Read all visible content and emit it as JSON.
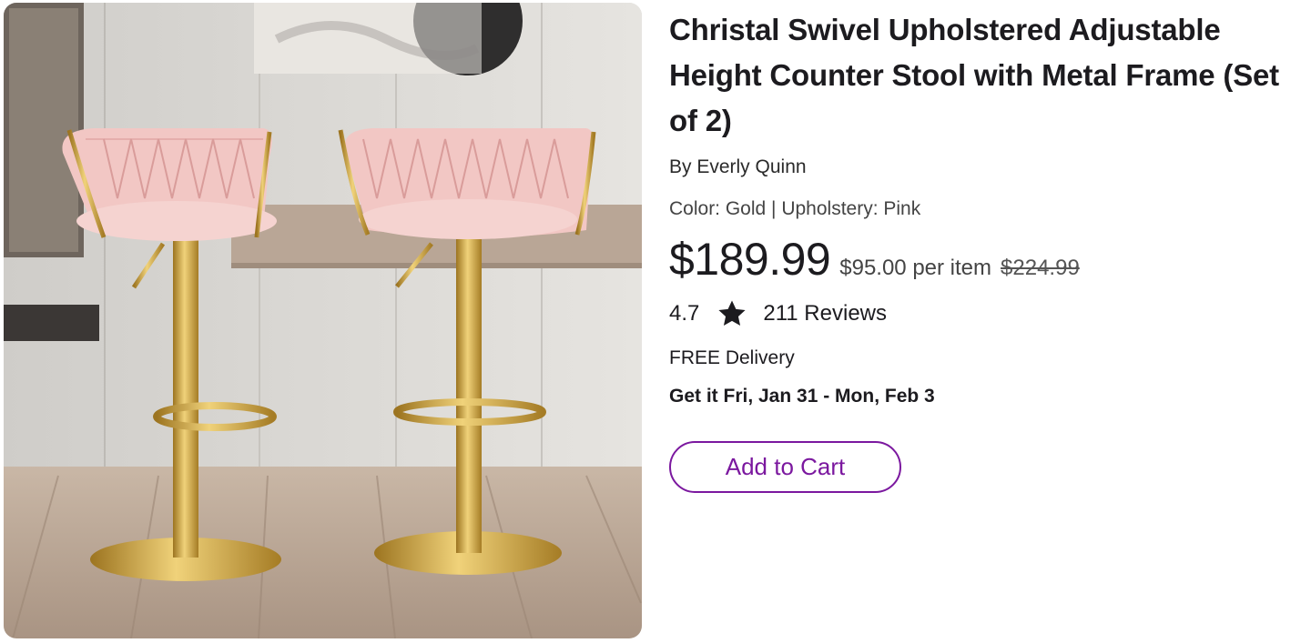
{
  "product": {
    "title": "Christal Swivel Upholstered Adjustable Height Counter Stool with Metal Frame (Set of 2)",
    "brand": "By Everly Quinn",
    "options": "Color: Gold | Upholstery: Pink",
    "price": "$189.99",
    "per_item": "$95.00 per item",
    "original_price": "$224.99",
    "rating": "4.7",
    "reviews": "211 Reviews",
    "delivery": "FREE Delivery",
    "delivery_date": "Get it Fri, Jan 31 - Mon, Feb 3",
    "add_to_cart_label": "Add to Cart",
    "image_icon": "product-photo"
  },
  "colors": {
    "accent": "#7b189f",
    "text": "#1c1b1f",
    "gold": "#c9a233",
    "upholstery": "#f2c7c4"
  }
}
